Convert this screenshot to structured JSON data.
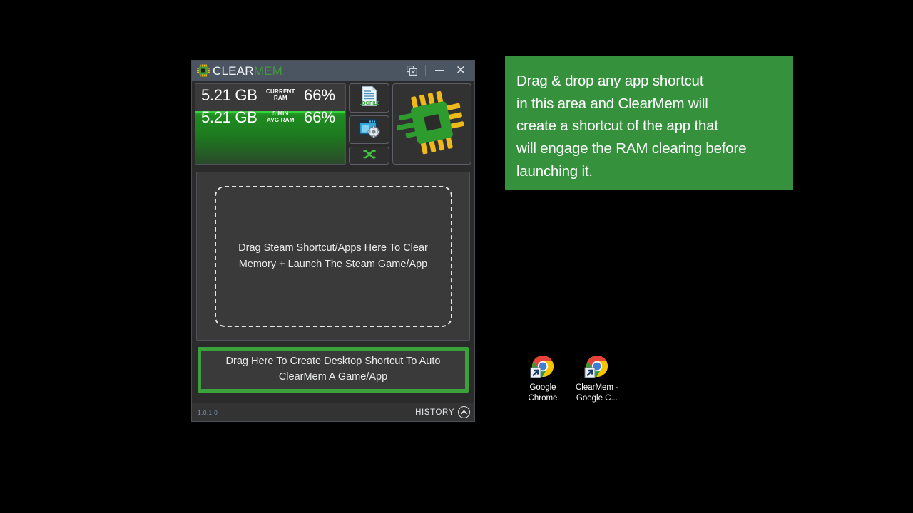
{
  "window": {
    "logo_icon": "cpu-chip-icon",
    "title_clear": "CLEAR",
    "title_mem": "MEM",
    "controls": {
      "tray_icon": "minimize-to-tray-icon",
      "minimize_icon": "minimize-icon",
      "close_icon": "close-icon"
    },
    "accent_green": "#3ba23b",
    "titlebar_color": "#4b5562"
  },
  "stats": {
    "current": {
      "value": "5.21 GB",
      "label": "CURRENT\nRAM",
      "percent": "66%"
    },
    "average": {
      "value": "5.21 GB",
      "label": "5 MIN\nAVG RAM",
      "percent": "66%"
    },
    "fill_percent": 66
  },
  "buttons": [
    {
      "name": "log-button",
      "icon": "document-log-icon"
    },
    {
      "name": "settings-button",
      "icon": "window-gear-icon"
    },
    {
      "name": "shuffle-button",
      "icon": "shuffle-icon"
    }
  ],
  "cpu_panel": {
    "icon": "cpu-chip-logo"
  },
  "dropzone": {
    "text": "Drag Steam Shortcut/Apps Here To Clear Memory + Launch The Steam Game/App"
  },
  "shortcut_zone": {
    "text": "Drag Here To Create Desktop Shortcut To Auto ClearMem A Game/App"
  },
  "statusbar": {
    "version": "1.0.1.0",
    "history_label": "HISTORY",
    "history_icon": "chevron-up-icon"
  },
  "tooltip": {
    "text": "Drag & drop any app shortcut\nin this area and ClearMem will\ncreate a shortcut of the app that\nwill engage the RAM clearing before\nlaunching it.",
    "background": "#36913d"
  },
  "desktop_icons": [
    {
      "label": "Google\nChrome",
      "icon": "chrome-shortcut-icon"
    },
    {
      "label": "ClearMem -\nGoogle C...",
      "icon": "chrome-shortcut-icon"
    }
  ]
}
